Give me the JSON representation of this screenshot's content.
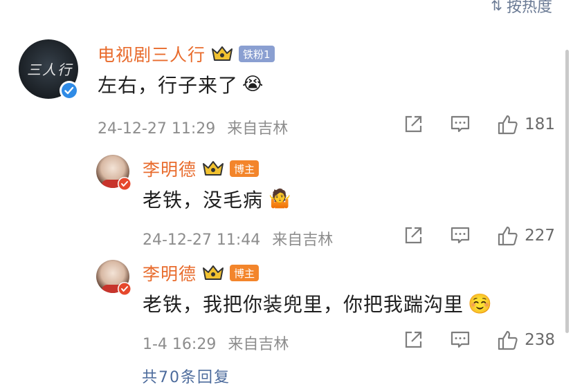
{
  "header": {
    "sort_label": "按热度",
    "sort_icon": "sort-icon"
  },
  "comments": [
    {
      "author": "电视剧三人行",
      "avatar_text": "三人行",
      "badge": "铁粉1",
      "text": "左右，行子来了",
      "emoji": "😭",
      "date": "24-12-27 11:29",
      "location": "来自吉林",
      "likes": "181"
    },
    {
      "author": "李明德",
      "badge": "博主",
      "text": "老铁，没毛病",
      "emoji": "🤷",
      "date": "24-12-27 11:44",
      "location": "来自吉林",
      "likes": "227"
    },
    {
      "author": "李明德",
      "badge": "博主",
      "text": "老铁，我把你装兜里，你把我踹沟里",
      "emoji": "☺️",
      "date": "1-4 16:29",
      "location": "来自吉林",
      "likes": "238"
    }
  ],
  "footer": {
    "more_replies": "共70条回复"
  },
  "colors": {
    "name": "#e86b2c",
    "fan_badge": "#8a9fd1",
    "host_badge": "#f3852b",
    "verify": "#2f8be6"
  }
}
